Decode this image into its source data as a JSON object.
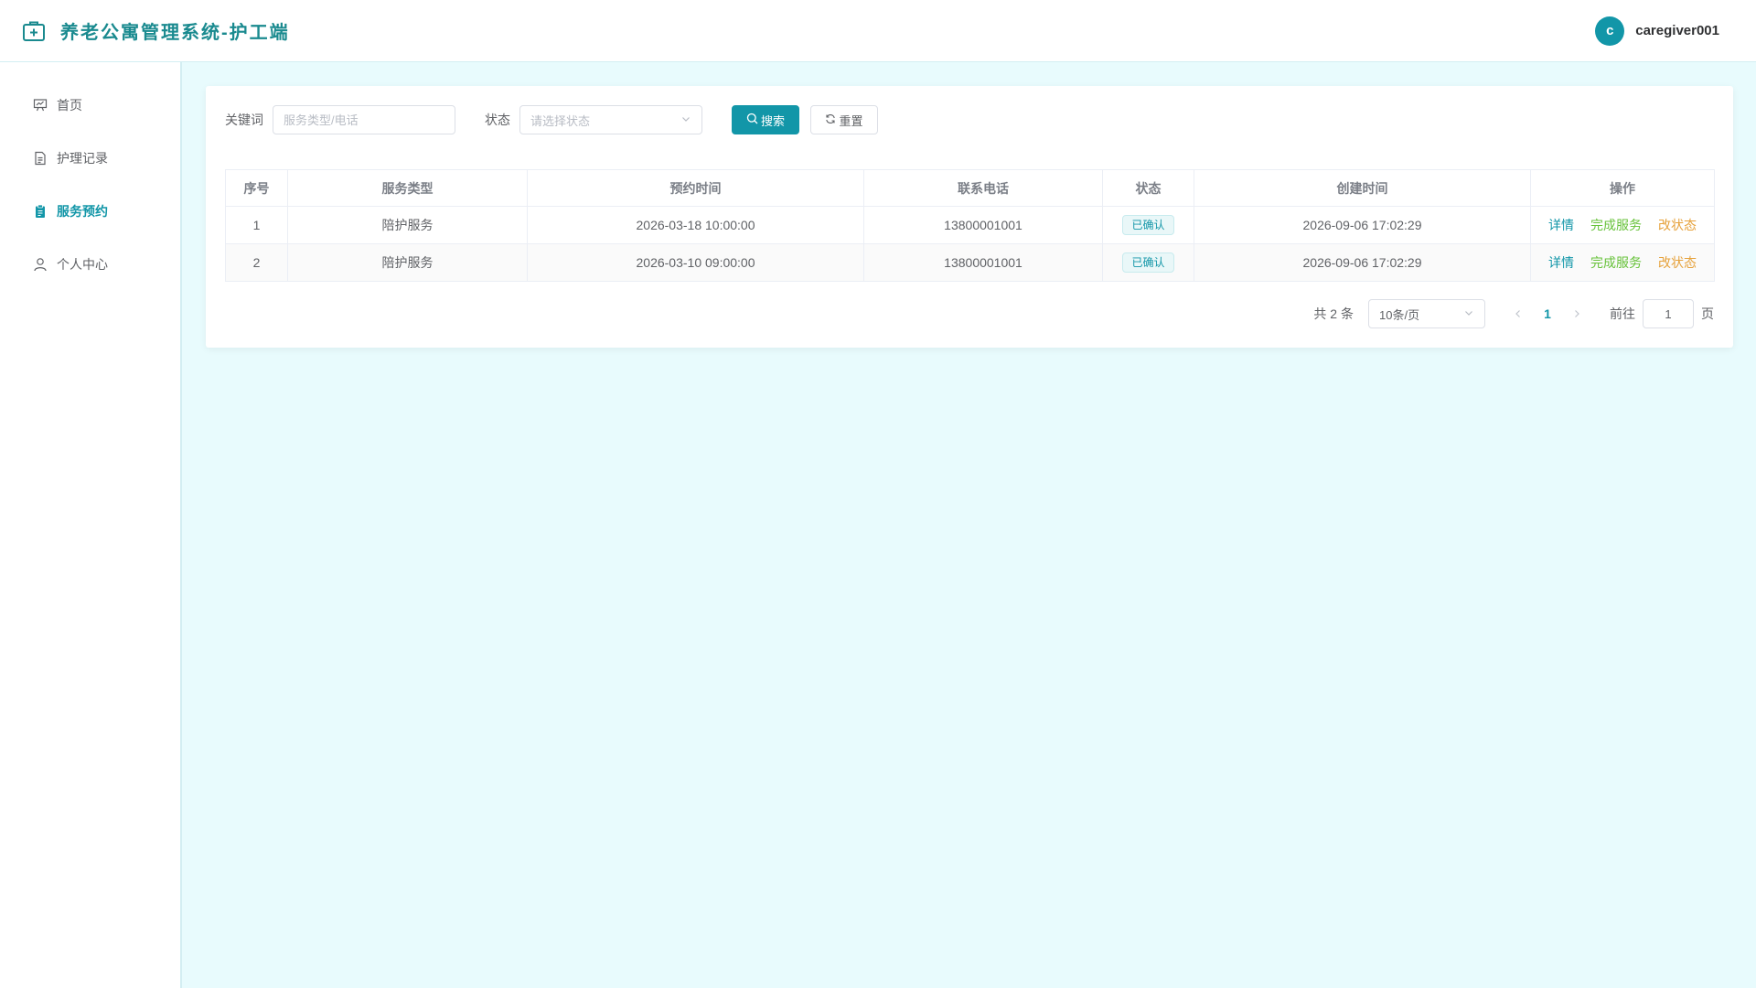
{
  "app": {
    "title": "养老公寓管理系统-护工端",
    "brand_color": "#1296a8"
  },
  "user": {
    "avatar_letter": "c",
    "name": "caregiver001"
  },
  "sidebar": {
    "items": [
      {
        "label": "首页",
        "icon": "presentation-icon",
        "active": false
      },
      {
        "label": "护理记录",
        "icon": "document-icon",
        "active": false
      },
      {
        "label": "服务预约",
        "icon": "clipboard-icon",
        "active": true
      },
      {
        "label": "个人中心",
        "icon": "user-icon",
        "active": false
      }
    ]
  },
  "search": {
    "keyword_label": "关键词",
    "keyword_placeholder": "服务类型/电话",
    "status_label": "状态",
    "status_placeholder": "请选择状态",
    "search_button": "搜索",
    "reset_button": "重置"
  },
  "table": {
    "columns": [
      "序号",
      "服务类型",
      "预约时间",
      "联系电话",
      "状态",
      "创建时间",
      "操作"
    ],
    "rows": [
      {
        "index": "1",
        "service_type": "陪护服务",
        "appointment_time": "2026-03-18 10:00:00",
        "phone": "13800001001",
        "status": "已确认",
        "created_at": "2026-09-06 17:02:29",
        "actions": {
          "detail": "详情",
          "complete": "完成服务",
          "change_status": "改状态"
        }
      },
      {
        "index": "2",
        "service_type": "陪护服务",
        "appointment_time": "2026-03-10 09:00:00",
        "phone": "13800001001",
        "status": "已确认",
        "created_at": "2026-09-06 17:02:29",
        "actions": {
          "detail": "详情",
          "complete": "完成服务",
          "change_status": "改状态"
        }
      }
    ]
  },
  "pagination": {
    "total_text": "共 2 条",
    "page_size": "10条/页",
    "current_page": "1",
    "goto_label": "前往",
    "goto_value": "1",
    "page_unit": "页"
  }
}
